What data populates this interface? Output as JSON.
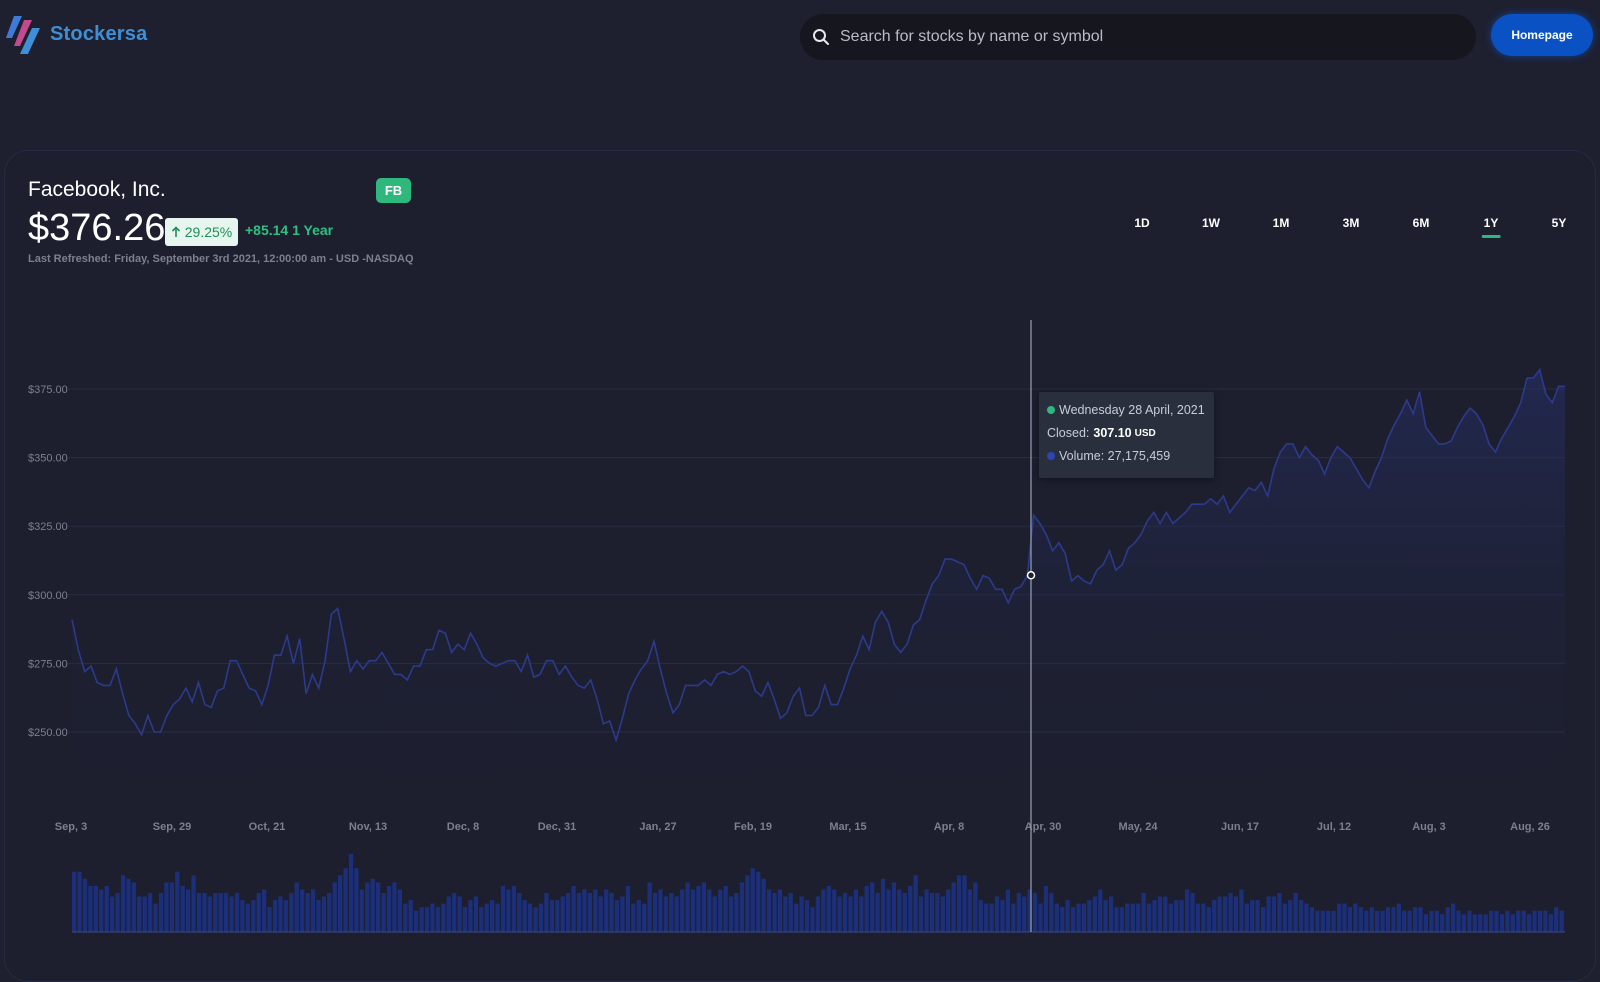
{
  "app": {
    "name": "Stockersa"
  },
  "search": {
    "placeholder": "Search for stocks by name or symbol"
  },
  "nav": {
    "homepage_label": "Homepage"
  },
  "stock": {
    "company": "Facebook, Inc.",
    "symbol": "FB",
    "price": "$376.26",
    "change_pct": "29.25%",
    "change_abs": "+85.14",
    "change_period": "1 Year",
    "last_refreshed": "Last Refreshed: Friday, September 3rd 2021, 12:00:00 am - USD -NASDAQ"
  },
  "ranges": {
    "items": [
      "1D",
      "1W",
      "1M",
      "3M",
      "6M",
      "1Y",
      "5Y"
    ],
    "active": "1Y"
  },
  "tooltip": {
    "date": "Wednesday 28 April, 2021",
    "closed_label": "Closed:",
    "closed_value": "307.10",
    "closed_unit": "USD",
    "volume_text": "Volume: 27,175,459"
  },
  "colors": {
    "background": "#1e2030",
    "line": "#2c3a8c",
    "volume_bar": "#1c2f7a",
    "accent_green": "#2fb87d",
    "button_blue": "#0a52c4",
    "brand": "#3f8fd6"
  },
  "chart_data": {
    "type": "area",
    "y_tick_labels": [
      "$375.00",
      "$350.00",
      "$325.00",
      "$300.00",
      "$275.00",
      "$250.00"
    ],
    "y_ticks": [
      375,
      350,
      325,
      300,
      275,
      250
    ],
    "ylim": [
      225,
      400
    ],
    "x_tick_labels": [
      "Sep, 3",
      "Sep, 29",
      "Oct, 21",
      "Nov, 13",
      "Dec, 8",
      "Dec, 31",
      "Jan, 27",
      "Feb, 19",
      "Mar, 15",
      "Apr, 8",
      "Apr, 30",
      "May, 24",
      "Jun, 17",
      "Jul, 12",
      "Aug, 3",
      "Aug, 26"
    ],
    "series": [
      {
        "values": [
          291,
          280,
          272,
          274,
          268,
          267,
          267,
          273,
          264,
          256,
          253,
          249,
          256,
          250,
          250,
          256,
          260,
          262,
          266,
          261,
          268,
          260,
          259,
          265,
          266,
          276,
          276,
          271,
          266,
          265,
          260,
          267,
          278,
          278,
          285,
          275,
          284,
          264,
          271,
          266,
          276,
          293,
          295,
          284,
          272,
          276,
          273,
          276,
          276,
          279,
          275,
          271,
          271,
          269,
          274,
          274,
          280,
          280,
          287,
          286,
          279,
          282,
          280,
          286,
          282,
          277,
          275,
          274,
          275,
          276,
          276,
          272,
          278,
          270,
          271,
          276,
          276,
          271,
          274,
          270,
          267,
          266,
          269,
          262,
          253,
          254,
          247,
          255,
          264,
          269,
          273,
          276,
          283,
          273,
          264,
          257,
          260,
          267,
          267,
          267,
          269,
          267,
          271,
          272,
          271,
          272,
          274,
          272,
          265,
          263,
          268,
          262,
          255,
          257,
          263,
          266,
          256,
          256,
          259,
          267,
          260,
          260,
          266,
          273,
          278,
          285,
          280,
          290,
          294,
          290,
          282,
          279,
          282,
          289,
          291,
          298,
          304,
          307,
          313,
          313,
          312,
          311,
          306,
          302,
          307,
          306,
          302,
          302,
          297,
          302,
          303,
          307,
          329,
          326,
          322,
          316,
          319,
          315,
          305,
          307,
          305,
          304,
          309,
          311,
          316,
          309,
          311,
          317,
          319,
          322,
          327,
          330,
          326,
          330,
          326,
          328,
          330,
          333,
          333,
          333,
          335,
          333,
          336,
          330,
          333,
          336,
          339,
          338,
          341,
          336,
          346,
          352,
          355,
          355,
          350,
          354,
          351,
          349,
          344,
          350,
          354,
          352,
          350,
          346,
          342,
          339,
          345,
          350,
          357,
          362,
          366,
          371,
          366,
          374,
          361,
          358,
          355,
          355,
          356,
          361,
          365,
          368,
          366,
          362,
          355,
          352,
          357,
          361,
          365,
          370,
          379,
          379,
          382,
          373,
          370,
          376,
          376
        ]
      },
      {
        "name": "Volume",
        "values": [
          17,
          17,
          15,
          13,
          13,
          12,
          13,
          10,
          11,
          16,
          15,
          14,
          10,
          10,
          11,
          8,
          11,
          14,
          14,
          17,
          13,
          12,
          16,
          11,
          11,
          10,
          11,
          11,
          11,
          10,
          11,
          9,
          8,
          9,
          11,
          12,
          7,
          9,
          10,
          9,
          11,
          14,
          12,
          11,
          12,
          9,
          10,
          11,
          14,
          16,
          18,
          22,
          18,
          12,
          14,
          15,
          14,
          11,
          13,
          14,
          12,
          8,
          9,
          6,
          7,
          7,
          8,
          7,
          8,
          10,
          11,
          10,
          7,
          9,
          10,
          7,
          8,
          9,
          8,
          13,
          12,
          13,
          11,
          9,
          8,
          7,
          8,
          11,
          9,
          9,
          10,
          11,
          13,
          11,
          12,
          11,
          12,
          10,
          12,
          11,
          9,
          10,
          13,
          8,
          9,
          8,
          14,
          11,
          12,
          10,
          11,
          10,
          12,
          14,
          12,
          13,
          14,
          12,
          10,
          12,
          13,
          10,
          11,
          14,
          16,
          18,
          17,
          15,
          12,
          11,
          12,
          10,
          11,
          8,
          10,
          9,
          7,
          10,
          12,
          13,
          12,
          10,
          11,
          10,
          12,
          10,
          13,
          14,
          11,
          15,
          12,
          14,
          12,
          11,
          13,
          16,
          10,
          12,
          11,
          11,
          10,
          12,
          14,
          16,
          16,
          12,
          14,
          9,
          8,
          8,
          10,
          9,
          12,
          8,
          11,
          10,
          12,
          11,
          8,
          13,
          11,
          8,
          7,
          9,
          7,
          8,
          8,
          9,
          10,
          12,
          9,
          10,
          7,
          7,
          8,
          8,
          8,
          11,
          8,
          9,
          10,
          10,
          8,
          9,
          9,
          12,
          11,
          8,
          8,
          7,
          9,
          10,
          10,
          11,
          10,
          12,
          8,
          9,
          9,
          7,
          10,
          10,
          11,
          8,
          9,
          11,
          9,
          8,
          7,
          6,
          6,
          6,
          6,
          8,
          8,
          7,
          8,
          7,
          6,
          7,
          6,
          6,
          7,
          7,
          8,
          6,
          6,
          7,
          7,
          5,
          6,
          6,
          5,
          7,
          8,
          6,
          5,
          6,
          5,
          5,
          5,
          6,
          6,
          5,
          6,
          5,
          6,
          6,
          5,
          6,
          6,
          6,
          5,
          7,
          6
        ]
      }
    ],
    "hover": {
      "date": "Wednesday 28 April, 2021",
      "close": 307.1,
      "volume": 27175459
    },
    "grid": true
  }
}
